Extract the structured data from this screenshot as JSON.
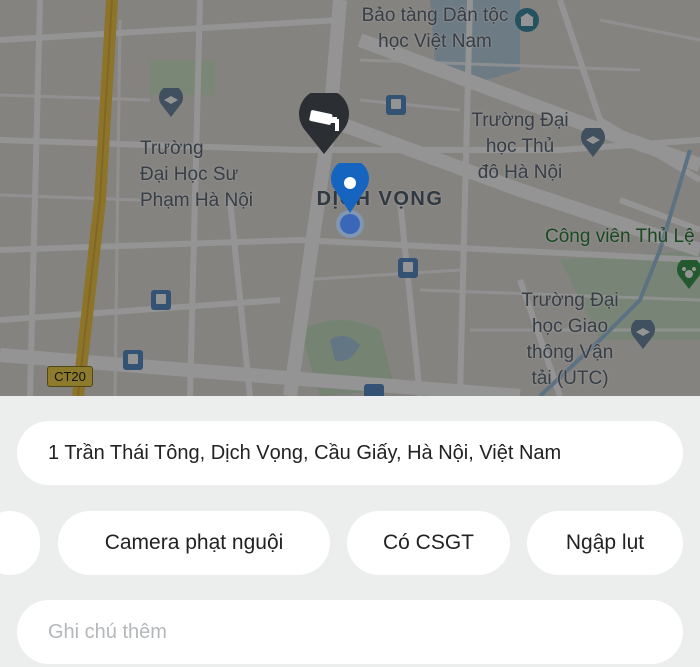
{
  "map": {
    "labels": {
      "museum": "Bảo tàng Dân tộc\nhọc Việt Nam",
      "pedagogy_univ": "Trường\nĐại Học Sư\nPhạm Hà Nội",
      "capital_univ": "Trường Đại\nhọc Thủ\nđô Hà Nội",
      "district": "DỊCH VỌNG",
      "park": "Công viên Thủ Lệ",
      "transport_univ": "Trường Đại\nhọc Giao\nthông Vận\ntải (UTC)"
    },
    "road_shield": "CT20",
    "icons": [
      "traffic-camera-icon",
      "location-pin-icon",
      "bus-stop-icon",
      "university-icon",
      "museum-icon",
      "zoo-icon"
    ]
  },
  "form": {
    "address": "1 Trần Thái Tông, Dịch Vọng, Cầu Giấy, Hà Nội, Việt Nam",
    "chips": [
      "Camera phạt nguội",
      "Có CSGT",
      "Ngập lụt"
    ],
    "note_placeholder": "Ghi chú thêm"
  },
  "colors": {
    "pin": "#1565c0",
    "camera_badge": "#2b2f33",
    "panel_bg": "#eceeed"
  }
}
